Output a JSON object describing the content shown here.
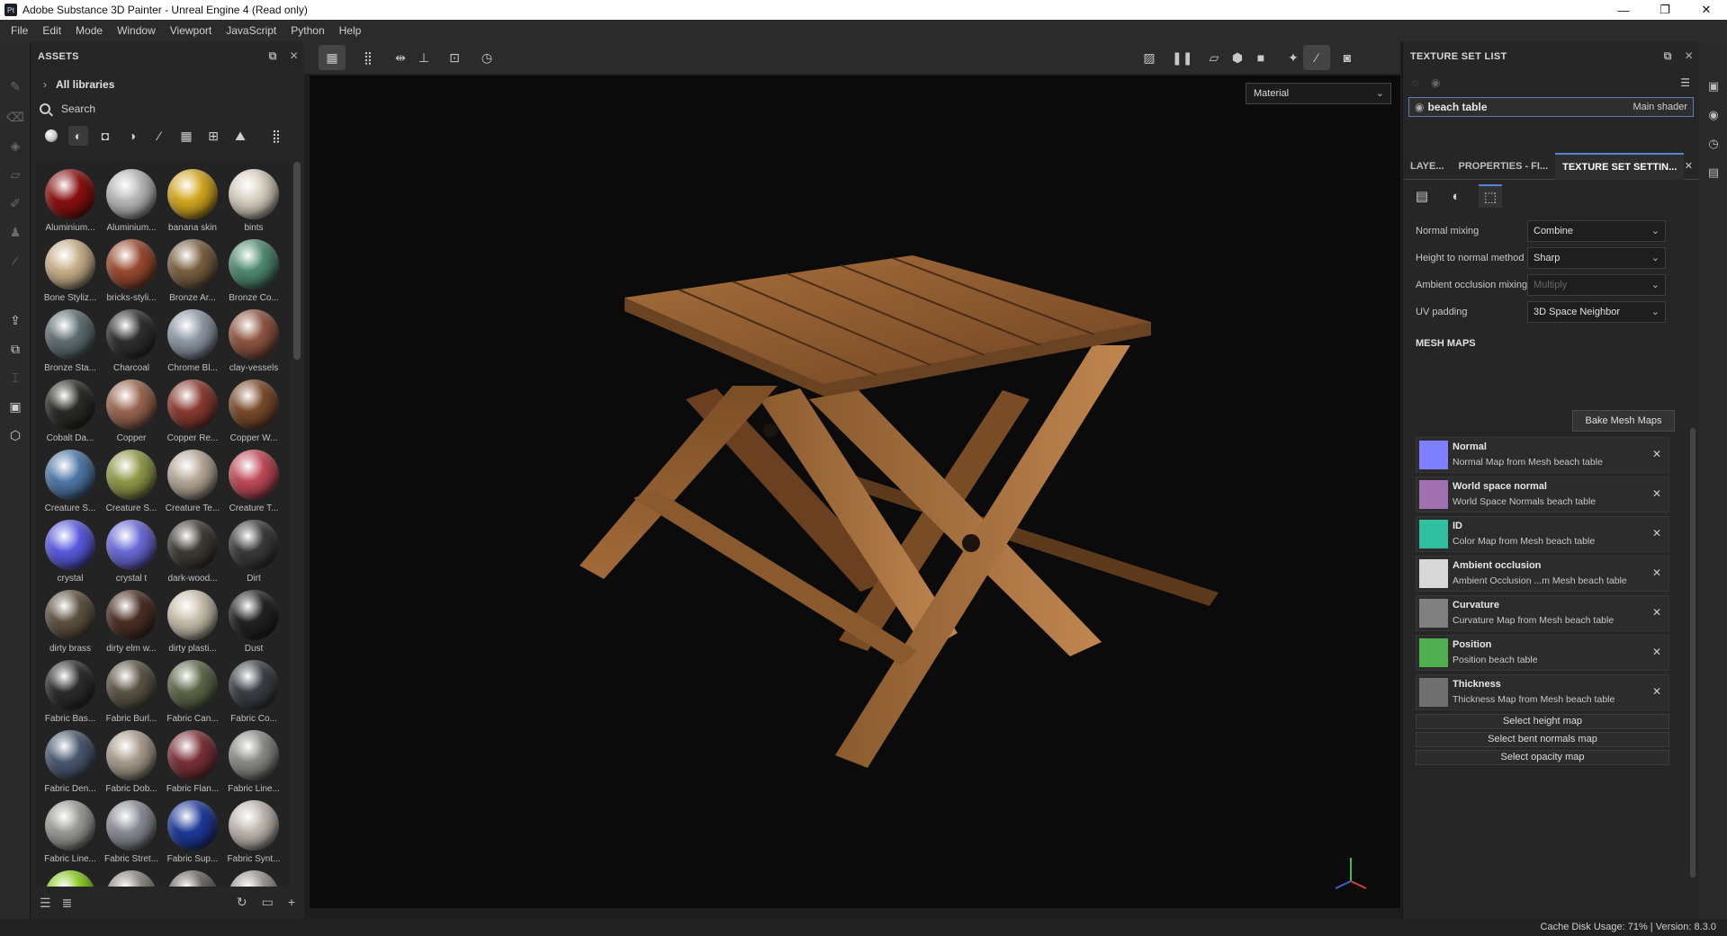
{
  "window": {
    "app_icon_text": "Pt",
    "title": "Adobe Substance 3D Painter - Unreal Engine 4 (Read only)",
    "controls": [
      "—",
      "❐",
      "✕"
    ]
  },
  "menu": [
    "File",
    "Edit",
    "Mode",
    "Window",
    "Viewport",
    "JavaScript",
    "Python",
    "Help"
  ],
  "assets": {
    "title": "ASSETS",
    "library": "All libraries",
    "search_placeholder": "Search",
    "items": [
      {
        "label": "Aluminium...",
        "color": "#8a1010"
      },
      {
        "label": "Aluminium...",
        "color": "#b8b8b8"
      },
      {
        "label": "banana skin",
        "color": "#d4a820"
      },
      {
        "label": "bints",
        "color": "#d8d0c0"
      },
      {
        "label": "Bone Styliz...",
        "color": "#c9b08a"
      },
      {
        "label": "bricks-styli...",
        "color": "#9a4a30"
      },
      {
        "label": "Bronze Ar...",
        "color": "#7a6040"
      },
      {
        "label": "Bronze Co...",
        "color": "#4f8a70"
      },
      {
        "label": "Bronze Sta...",
        "color": "#5e6e70"
      },
      {
        "label": "Charcoal",
        "color": "#2e2e2e"
      },
      {
        "label": "Chrome Bl...",
        "color": "#8f98a4"
      },
      {
        "label": "clay-vessels",
        "color": "#8e5540"
      },
      {
        "label": "Cobalt Da...",
        "color": "#2a2a28"
      },
      {
        "label": "Copper",
        "color": "#9a6650"
      },
      {
        "label": "Copper Re...",
        "color": "#8a3a30"
      },
      {
        "label": "Copper W...",
        "color": "#7a4a2a"
      },
      {
        "label": "Creature S...",
        "color": "#4f78a8"
      },
      {
        "label": "Creature S...",
        "color": "#8f9a48"
      },
      {
        "label": "Creature Te...",
        "color": "#b6a898"
      },
      {
        "label": "Creature T...",
        "color": "#c04a58"
      },
      {
        "label": "crystal",
        "color": "#5a5ae0"
      },
      {
        "label": "crystal t",
        "color": "#6a6ad8"
      },
      {
        "label": "dark-wood...",
        "color": "#3e3a34"
      },
      {
        "label": "Dirt",
        "color": "#3a3a3a"
      },
      {
        "label": "dirty brass",
        "color": "#5e5240"
      },
      {
        "label": "dirty elm w...",
        "color": "#4a2e24"
      },
      {
        "label": "dirty plasti...",
        "color": "#c8c0ac"
      },
      {
        "label": "Dust",
        "color": "#222222"
      },
      {
        "label": "Fabric Bas...",
        "color": "#2c2c2c"
      },
      {
        "label": "Fabric Burl...",
        "color": "#5a5444"
      },
      {
        "label": "Fabric Can...",
        "color": "#5e6648"
      },
      {
        "label": "Fabric Co...",
        "color": "#3c3e44"
      },
      {
        "label": "Fabric Den...",
        "color": "#4a5870"
      },
      {
        "label": "Fabric Dob...",
        "color": "#a89c8c"
      },
      {
        "label": "Fabric Flan...",
        "color": "#7a3038"
      },
      {
        "label": "Fabric Line...",
        "color": "#8a8a88"
      },
      {
        "label": "Fabric Line...",
        "color": "#9a9a98"
      },
      {
        "label": "Fabric Stret...",
        "color": "#8a8c94"
      },
      {
        "label": "Fabric Sup...",
        "color": "#1e3a9a"
      },
      {
        "label": "Fabric Synt...",
        "color": "#c0b8b0"
      },
      {
        "label": "",
        "color": "#8acc20"
      },
      {
        "label": "",
        "color": "#8a8680"
      },
      {
        "label": "",
        "color": "#6a6660"
      },
      {
        "label": "",
        "color": "#9a9690"
      }
    ]
  },
  "viewport": {
    "mode_select": "Material"
  },
  "texture_set_list": {
    "title": "TEXTURE SET LIST",
    "set_name": "beach table",
    "shader": "Main shader"
  },
  "tabs": [
    "LAYE...",
    "PROPERTIES - FI...",
    "TEXTURE SET SETTIN..."
  ],
  "settings": {
    "rows": [
      {
        "label": "Normal mixing",
        "value": "Combine",
        "disabled": false
      },
      {
        "label": "Height to normal method",
        "value": "Sharp",
        "disabled": false
      },
      {
        "label": "Ambient occlusion mixing",
        "value": "Multiply",
        "disabled": true
      },
      {
        "label": "UV padding",
        "value": "3D Space Neighbor",
        "disabled": false
      }
    ],
    "mesh_maps_title": "MESH MAPS",
    "bake_button": "Bake Mesh Maps",
    "maps": [
      {
        "name": "Normal",
        "sub": "Normal Map from Mesh beach table",
        "color": "#7f80ff"
      },
      {
        "name": "World space normal",
        "sub": "World Space Normals beach table",
        "color": "#a070b0"
      },
      {
        "name": "ID",
        "sub": "Color Map from Mesh beach table",
        "color": "#30c0a0"
      },
      {
        "name": "Ambient occlusion",
        "sub": "Ambient Occlusion ...m Mesh beach table",
        "color": "#d8d8d8"
      },
      {
        "name": "Curvature",
        "sub": "Curvature Map from Mesh beach table",
        "color": "#808080"
      },
      {
        "name": "Position",
        "sub": "Position beach table",
        "color": "#50b050"
      },
      {
        "name": "Thickness",
        "sub": "Thickness Map from Mesh beach table",
        "color": "#707070"
      }
    ],
    "select_buttons": [
      "Select height map",
      "Select bent normals map",
      "Select opacity map"
    ]
  },
  "status": {
    "text": "Cache Disk Usage:   71% | Version: 8.3.0"
  }
}
